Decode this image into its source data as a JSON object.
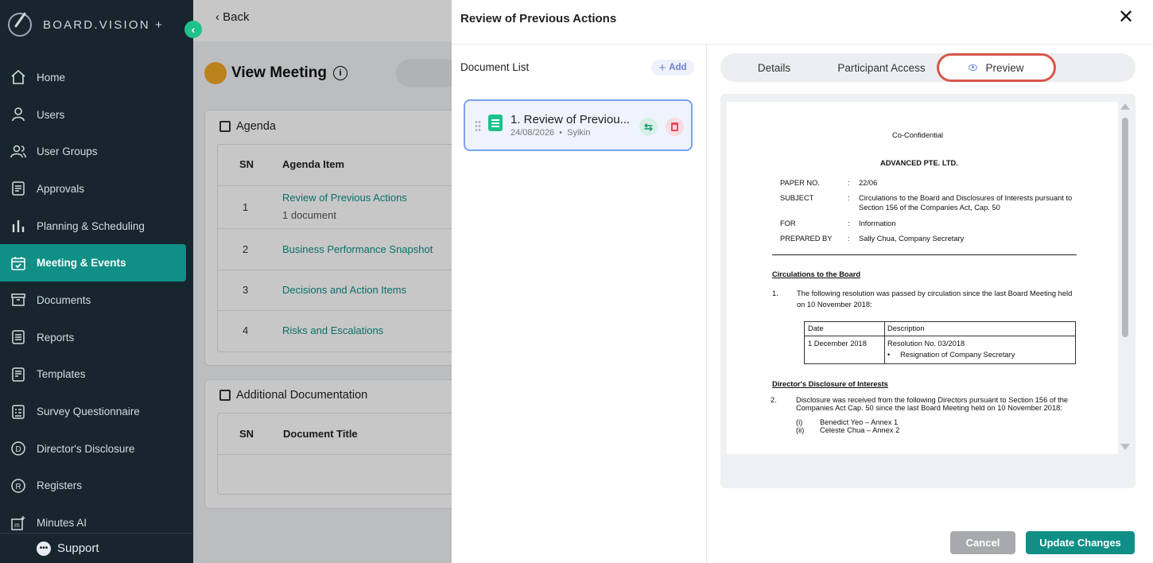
{
  "sidebar": {
    "brand": "BOARD.VISION +",
    "items": [
      {
        "label": "Home",
        "icon": "home-icon"
      },
      {
        "label": "Users",
        "icon": "user-icon"
      },
      {
        "label": "User Groups",
        "icon": "users-icon"
      },
      {
        "label": "Approvals",
        "icon": "clipboard-icon"
      },
      {
        "label": "Planning & Scheduling",
        "icon": "bar-chart-icon"
      },
      {
        "label": "Meeting & Events",
        "icon": "calendar-check-icon",
        "active": true
      },
      {
        "label": "Documents",
        "icon": "archive-icon"
      },
      {
        "label": "Reports",
        "icon": "report-icon"
      },
      {
        "label": "Templates",
        "icon": "template-icon"
      },
      {
        "label": "Survey Questionnaire",
        "icon": "survey-icon"
      },
      {
        "label": "Director's Disclosure",
        "icon": "d-circle-icon"
      },
      {
        "label": "Registers",
        "icon": "r-circle-icon"
      },
      {
        "label": "Minutes AI",
        "icon": "minutes-ai-icon"
      }
    ],
    "support": "Support"
  },
  "page": {
    "back": "Back",
    "title": "View Meeting",
    "agenda": {
      "title": "Agenda",
      "headers": [
        "SN",
        "Agenda Item"
      ],
      "rows": [
        {
          "sn": "1",
          "item": "Review of Previous Actions",
          "sub": "1 document"
        },
        {
          "sn": "2",
          "item": "Business Performance Snapshot"
        },
        {
          "sn": "3",
          "item": "Decisions and Action Items"
        },
        {
          "sn": "4",
          "item": "Risks and Escalations"
        }
      ]
    },
    "additional": {
      "title": "Additional Documentation",
      "headers": [
        "SN",
        "Document Title"
      ]
    }
  },
  "modal": {
    "title": "Review of Previous Actions",
    "document_list_label": "Document List",
    "add_label": "Add",
    "document": {
      "name": "1. Review of Previou...",
      "date": "24/08/2026",
      "author": "Syikin"
    },
    "tabs": [
      "Details",
      "Participant Access",
      "Preview"
    ],
    "active_tab": "Preview",
    "preview": {
      "confidential": "Co-Confidential",
      "company": "ADVANCED PTE. LTD.",
      "fields": [
        {
          "label": "PAPER NO.",
          "value": "22/06"
        },
        {
          "label": "SUBJECT",
          "value": "Circulations to the Board and Disclosures of Interests pursuant to",
          "value2": "Section 156 of the Companies Act, Cap. 50"
        },
        {
          "label": "FOR",
          "value": "Information"
        },
        {
          "label": "PREPARED BY",
          "value": "Sally Chua, Company Secretary"
        }
      ],
      "section1": "Circulations to the Board",
      "item1_num": "1.",
      "item1_line1": "The following resolution was passed by circulation since the last Board Meeting held",
      "item1_line2": "on 10 November 2018:",
      "table_headers": [
        "Date",
        "Description"
      ],
      "table_date": "1 December 2018",
      "table_desc": "Resolution No. 03/2018",
      "table_bullet": "Resignation of Company Secretary",
      "section2": "Director's Disclosure of Interests",
      "item2_num": "2.",
      "item2_line1": "Disclosure was received from the following Directors pursuant to Section 156 of the",
      "item2_line2": "Companies Act Cap. 50 since the last Board Meeting held on 10 November 2018:",
      "annex": [
        {
          "num": "(i)",
          "text": "Benedict Yeo – Annex 1"
        },
        {
          "num": "(ii)",
          "text": "Celeste Chua – Annex 2"
        }
      ]
    },
    "cancel": "Cancel",
    "update": "Update Changes"
  }
}
